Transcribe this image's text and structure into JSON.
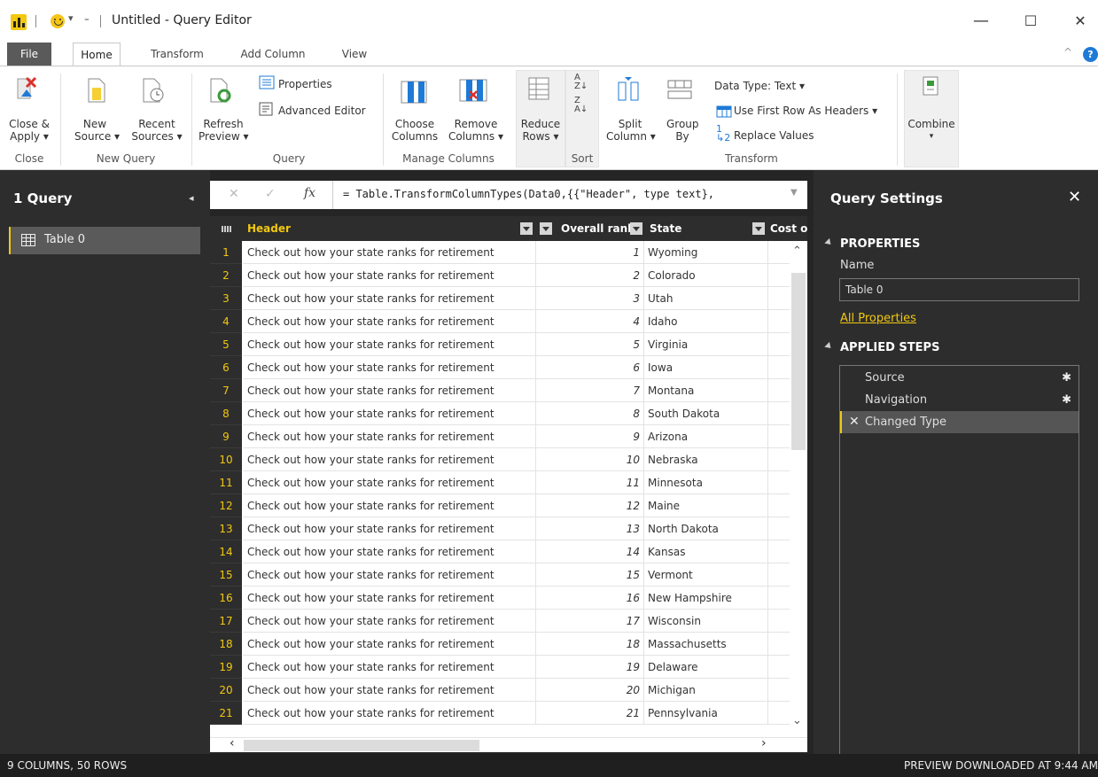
{
  "window": {
    "title": "Untitled - Query Editor",
    "minimize": "—",
    "maximize": "☐",
    "close": "✕"
  },
  "tabs": {
    "file": "File",
    "home": "Home",
    "transform": "Transform",
    "add_column": "Add Column",
    "view": "View"
  },
  "ribbon": {
    "close_apply": [
      "Close &",
      "Apply ▾"
    ],
    "new_source": [
      "New",
      "Source ▾"
    ],
    "recent_sources": [
      "Recent",
      "Sources ▾"
    ],
    "refresh_preview": [
      "Refresh",
      "Preview ▾"
    ],
    "properties": "Properties",
    "advanced_editor": "Advanced Editor",
    "choose_columns": [
      "Choose",
      "Columns"
    ],
    "remove_columns": [
      "Remove",
      "Columns ▾"
    ],
    "reduce_rows": [
      "Reduce",
      "Rows ▾"
    ],
    "split_column": [
      "Split",
      "Column ▾"
    ],
    "group_by": [
      "Group",
      "By"
    ],
    "data_type": "Data Type: Text ▾",
    "first_row_headers": "Use First Row As Headers ▾",
    "replace_values": "Replace Values",
    "combine": "Combine",
    "groups": {
      "close": "Close",
      "new_query": "New Query",
      "query": "Query",
      "manage_columns": "Manage Columns",
      "sort": "Sort",
      "transform": "Transform"
    }
  },
  "queries_pane": {
    "title": "1 Query",
    "items": [
      {
        "label": "Table 0"
      }
    ]
  },
  "formula_bar": {
    "text": "= Table.TransformColumnTypes(Data0,{{\"Header\", type text},"
  },
  "grid": {
    "columns": [
      "Header",
      "Overall rank",
      "State",
      "Cost of"
    ],
    "rows": [
      {
        "n": "1",
        "header": "Check out how your state ranks for retirement",
        "rank": "1",
        "state": "Wyoming"
      },
      {
        "n": "2",
        "header": "Check out how your state ranks for retirement",
        "rank": "2",
        "state": "Colorado"
      },
      {
        "n": "3",
        "header": "Check out how your state ranks for retirement",
        "rank": "3",
        "state": "Utah"
      },
      {
        "n": "4",
        "header": "Check out how your state ranks for retirement",
        "rank": "4",
        "state": "Idaho"
      },
      {
        "n": "5",
        "header": "Check out how your state ranks for retirement",
        "rank": "5",
        "state": "Virginia"
      },
      {
        "n": "6",
        "header": "Check out how your state ranks for retirement",
        "rank": "6",
        "state": "Iowa"
      },
      {
        "n": "7",
        "header": "Check out how your state ranks for retirement",
        "rank": "7",
        "state": "Montana"
      },
      {
        "n": "8",
        "header": "Check out how your state ranks for retirement",
        "rank": "8",
        "state": "South Dakota"
      },
      {
        "n": "9",
        "header": "Check out how your state ranks for retirement",
        "rank": "9",
        "state": "Arizona"
      },
      {
        "n": "10",
        "header": "Check out how your state ranks for retirement",
        "rank": "10",
        "state": "Nebraska"
      },
      {
        "n": "11",
        "header": "Check out how your state ranks for retirement",
        "rank": "11",
        "state": "Minnesota"
      },
      {
        "n": "12",
        "header": "Check out how your state ranks for retirement",
        "rank": "12",
        "state": "Maine"
      },
      {
        "n": "13",
        "header": "Check out how your state ranks for retirement",
        "rank": "13",
        "state": "North Dakota"
      },
      {
        "n": "14",
        "header": "Check out how your state ranks for retirement",
        "rank": "14",
        "state": "Kansas"
      },
      {
        "n": "15",
        "header": "Check out how your state ranks for retirement",
        "rank": "15",
        "state": "Vermont"
      },
      {
        "n": "16",
        "header": "Check out how your state ranks for retirement",
        "rank": "16",
        "state": "New Hampshire"
      },
      {
        "n": "17",
        "header": "Check out how your state ranks for retirement",
        "rank": "17",
        "state": "Wisconsin"
      },
      {
        "n": "18",
        "header": "Check out how your state ranks for retirement",
        "rank": "18",
        "state": "Massachusetts"
      },
      {
        "n": "19",
        "header": "Check out how your state ranks for retirement",
        "rank": "19",
        "state": "Delaware"
      },
      {
        "n": "20",
        "header": "Check out how your state ranks for retirement",
        "rank": "20",
        "state": "Michigan"
      },
      {
        "n": "21",
        "header": "Check out how your state ranks for retirement",
        "rank": "21",
        "state": "Pennsylvania"
      }
    ]
  },
  "settings": {
    "title": "Query Settings",
    "properties_heading": "PROPERTIES",
    "name_label": "Name",
    "name_value": "Table 0",
    "all_properties": "All Properties",
    "steps_heading": "APPLIED STEPS",
    "steps": [
      {
        "label": "Source"
      },
      {
        "label": "Navigation"
      },
      {
        "label": "Changed Type"
      }
    ]
  },
  "status": {
    "left": "9 COLUMNS, 50 ROWS",
    "right": "PREVIEW DOWNLOADED AT 9:44 AM"
  },
  "colors": {
    "accent": "#f2c811",
    "dark_pane": "#2d2d2d"
  }
}
